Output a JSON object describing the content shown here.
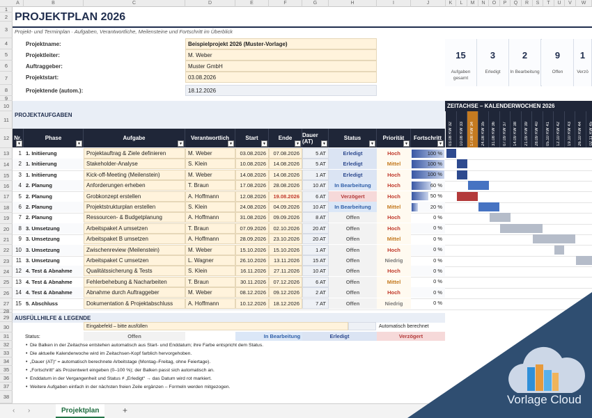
{
  "columns": [
    "A",
    "B",
    "C",
    "D",
    "E",
    "F",
    "G",
    "H",
    "I",
    "J",
    "K",
    "L",
    "M",
    "N",
    "O",
    "P",
    "Q",
    "R",
    "S",
    "T",
    "U",
    "V",
    "W"
  ],
  "rows": [
    "1",
    "2",
    "3",
    "4",
    "5",
    "6",
    "7",
    "8",
    "9",
    "10",
    "11",
    "12",
    "13",
    "14",
    "15",
    "16",
    "17",
    "18",
    "19",
    "20",
    "21",
    "22",
    "23",
    "24",
    "25",
    "26",
    "27",
    "28",
    "29",
    "30",
    "31",
    "32",
    "33",
    "34",
    "35",
    "36",
    "37",
    "38"
  ],
  "header": {
    "title": "PROJEKTPLAN 2026",
    "subtitle": "Projekt- und Terminplan · Aufgaben, Verantwortliche, Meilensteine und Fortschritt im Überblick"
  },
  "info": [
    {
      "label": "Projektname:",
      "value": "Beispielprojekt 2026 (Muster-Vorlage)",
      "bold": true,
      "kind": "input"
    },
    {
      "label": "Projektleiter:",
      "value": "M. Weber",
      "kind": "input"
    },
    {
      "label": "Auftraggeber:",
      "value": "Muster GmbH",
      "kind": "input"
    },
    {
      "label": "Projektstart:",
      "value": "03.08.2026",
      "kind": "input"
    },
    {
      "label": "Projektende (autom.):",
      "value": "18.12.2026",
      "kind": "calc"
    }
  ],
  "kpis": [
    {
      "value": "15",
      "label": "Aufgaben gesamt"
    },
    {
      "value": "3",
      "label": "Erledigt"
    },
    {
      "value": "2",
      "label": "In Bearbeitung"
    },
    {
      "value": "9",
      "label": "Offen"
    },
    {
      "value": "1",
      "label": "Verzö"
    }
  ],
  "section_tasks": "PROJEKTAUFGABEN",
  "section_timeline": "ZEITACHSE – KALENDERWOCHEN 2026",
  "table_headers": [
    "Nr.",
    "Phase",
    "Aufgabe",
    "Verantwortlich",
    "Start",
    "Ende",
    "Dauer (AT)",
    "Status",
    "Priorität",
    "Fortschritt"
  ],
  "weeks": [
    {
      "kw": "KW 32",
      "date": "03.08"
    },
    {
      "kw": "KW 33",
      "date": "10.08"
    },
    {
      "kw": "KW 34",
      "date": "17.08"
    },
    {
      "kw": "KW 35",
      "date": "24.08"
    },
    {
      "kw": "KW 36",
      "date": "31.08"
    },
    {
      "kw": "KW 37",
      "date": "07.09"
    },
    {
      "kw": "KW 38",
      "date": "14.09"
    },
    {
      "kw": "KW 39",
      "date": "21.09"
    },
    {
      "kw": "KW 40",
      "date": "28.09"
    },
    {
      "kw": "KW 41",
      "date": "05.10"
    },
    {
      "kw": "KW 42",
      "date": "12.10"
    },
    {
      "kw": "KW 43",
      "date": "19.10"
    },
    {
      "kw": "KW 44",
      "date": "26.10"
    },
    {
      "kw": "KW 45",
      "date": "02.11"
    }
  ],
  "current_week_index": 2,
  "tasks": [
    {
      "nr": "1",
      "phase": "1. Initiierung",
      "task": "Projektauftrag & Ziele definieren",
      "owner": "M. Weber",
      "start": "03.08.2026",
      "end": "07.08.2026",
      "dur": "5 AT",
      "status": "Erledigt",
      "prio": "Hoch",
      "progress": 100,
      "progress_label": "100 %",
      "bar": [
        0,
        1
      ]
    },
    {
      "nr": "2",
      "phase": "1. Initiierung",
      "task": "Stakeholder-Analyse",
      "owner": "S. Klein",
      "start": "10.08.2026",
      "end": "14.08.2026",
      "dur": "5 AT",
      "status": "Erledigt",
      "prio": "Mittel",
      "progress": 100,
      "progress_label": "100 %",
      "bar": [
        1,
        1
      ]
    },
    {
      "nr": "3",
      "phase": "1. Initiierung",
      "task": "Kick-off-Meeting (Meilenstein)",
      "owner": "M. Weber",
      "start": "14.08.2026",
      "end": "14.08.2026",
      "dur": "1 AT",
      "status": "Erledigt",
      "prio": "Hoch",
      "progress": 100,
      "progress_label": "100 %",
      "bar": [
        1,
        1
      ]
    },
    {
      "nr": "4",
      "phase": "2. Planung",
      "task": "Anforderungen erheben",
      "owner": "T. Braun",
      "start": "17.08.2026",
      "end": "28.08.2026",
      "dur": "10 AT",
      "status": "In Bearbeitung",
      "prio": "Hoch",
      "progress": 60,
      "progress_label": "60 %",
      "bar": [
        2,
        2
      ]
    },
    {
      "nr": "5",
      "phase": "2. Planung",
      "task": "Grobkonzept erstellen",
      "owner": "A. Hoffmann",
      "start": "12.08.2026",
      "end": "19.08.2026",
      "dur": "6 AT",
      "status": "Verzögert",
      "prio": "Hoch",
      "progress": 50,
      "progress_label": "50 %",
      "bar": [
        1,
        2
      ],
      "late": true
    },
    {
      "nr": "6",
      "phase": "2. Planung",
      "task": "Projektstrukturplan erstellen",
      "owner": "S. Klein",
      "start": "24.08.2026",
      "end": "04.09.2026",
      "dur": "10 AT",
      "status": "In Bearbeitung",
      "prio": "Mittel",
      "progress": 20,
      "progress_label": "20 %",
      "bar": [
        3,
        2
      ]
    },
    {
      "nr": "7",
      "phase": "2. Planung",
      "task": "Ressourcen- & Budgetplanung",
      "owner": "A. Hoffmann",
      "start": "31.08.2026",
      "end": "09.09.2026",
      "dur": "8 AT",
      "status": "Offen",
      "prio": "Hoch",
      "progress": 0,
      "progress_label": "0 %",
      "bar": [
        4,
        2
      ]
    },
    {
      "nr": "8",
      "phase": "3. Umsetzung",
      "task": "Arbeitspaket A umsetzen",
      "owner": "T. Braun",
      "start": "07.09.2026",
      "end": "02.10.2026",
      "dur": "20 AT",
      "status": "Offen",
      "prio": "Hoch",
      "progress": 0,
      "progress_label": "0 %",
      "bar": [
        5,
        4
      ]
    },
    {
      "nr": "9",
      "phase": "3. Umsetzung",
      "task": "Arbeitspaket B umsetzen",
      "owner": "A. Hoffmann",
      "start": "28.09.2026",
      "end": "23.10.2026",
      "dur": "20 AT",
      "status": "Offen",
      "prio": "Mittel",
      "progress": 0,
      "progress_label": "0 %",
      "bar": [
        8,
        4
      ]
    },
    {
      "nr": "10",
      "phase": "3. Umsetzung",
      "task": "Zwischenreview (Meilenstein)",
      "owner": "M. Weber",
      "start": "15.10.2026",
      "end": "15.10.2026",
      "dur": "1 AT",
      "status": "Offen",
      "prio": "Hoch",
      "progress": 0,
      "progress_label": "0 %",
      "bar": [
        10,
        1
      ]
    },
    {
      "nr": "11",
      "phase": "3. Umsetzung",
      "task": "Arbeitspaket C umsetzen",
      "owner": "L. Wagner",
      "start": "26.10.2026",
      "end": "13.11.2026",
      "dur": "15 AT",
      "status": "Offen",
      "prio": "Niedrig",
      "progress": 0,
      "progress_label": "0 %",
      "bar": [
        12,
        2
      ]
    },
    {
      "nr": "12",
      "phase": "4. Test & Abnahme",
      "task": "Qualitätssicherung & Tests",
      "owner": "S. Klein",
      "start": "16.11.2026",
      "end": "27.11.2026",
      "dur": "10 AT",
      "status": "Offen",
      "prio": "Hoch",
      "progress": 0,
      "progress_label": "0 %",
      "bar": null
    },
    {
      "nr": "13",
      "phase": "4. Test & Abnahme",
      "task": "Fehlerbehebung & Nacharbeiten",
      "owner": "T. Braun",
      "start": "30.11.2026",
      "end": "07.12.2026",
      "dur": "6 AT",
      "status": "Offen",
      "prio": "Mittel",
      "progress": 0,
      "progress_label": "0 %",
      "bar": null
    },
    {
      "nr": "14",
      "phase": "4. Test & Abnahme",
      "task": "Abnahme durch Auftraggeber",
      "owner": "M. Weber",
      "start": "08.12.2026",
      "end": "09.12.2026",
      "dur": "2 AT",
      "status": "Offen",
      "prio": "Hoch",
      "progress": 0,
      "progress_label": "0 %",
      "bar": null
    },
    {
      "nr": "15",
      "phase": "5. Abschluss",
      "task": "Dokumentation & Projektabschluss",
      "owner": "A. Hoffmann",
      "start": "10.12.2026",
      "end": "18.12.2026",
      "dur": "7 AT",
      "status": "Offen",
      "prio": "Niedrig",
      "progress": 0,
      "progress_label": "0 %",
      "bar": null
    }
  ],
  "legend": {
    "title": "AUSFÜLLHILFE & LEGENDE",
    "input_label": "Eingabefeld – bitte ausfüllen",
    "calc_label": "Automatisch berechnet",
    "status_label": "Status:",
    "statuses": [
      "Offen",
      "In Bearbeitung",
      "Erledigt",
      "Verzögert"
    ],
    "notes": [
      "Die Balken in der Zeitachse entstehen automatisch aus Start- und Enddatum; ihre Farbe entspricht dem Status.",
      "Die aktuelle Kalenderwoche wird im Zeitachsen-Kopf farblich hervorgehoben.",
      "„Dauer (AT)“ = automatisch berechnete Arbeitstage (Montag–Freitag, ohne Feiertage).",
      "„Fortschritt“ als Prozentwert eingeben (0–100 %); der Balken passt sich automatisch an.",
      "Enddatum in der Vergangenheit und Status ≠ „Erledigt“ → das Datum wird rot markiert.",
      "Weitere Aufgaben einfach in der nächsten freien Zeile ergänzen – Formeln werden mitgezogen."
    ]
  },
  "sheet_tab": "Projektplan",
  "add_sheet": "+",
  "brand": "Vorlage Cloud",
  "colors": {
    "dark": "#1f2638",
    "accent": "#c47a20",
    "done": "#2e4a8f",
    "progress": "#4673c2",
    "late": "#b33a3a",
    "open": "#b5bcc9"
  }
}
